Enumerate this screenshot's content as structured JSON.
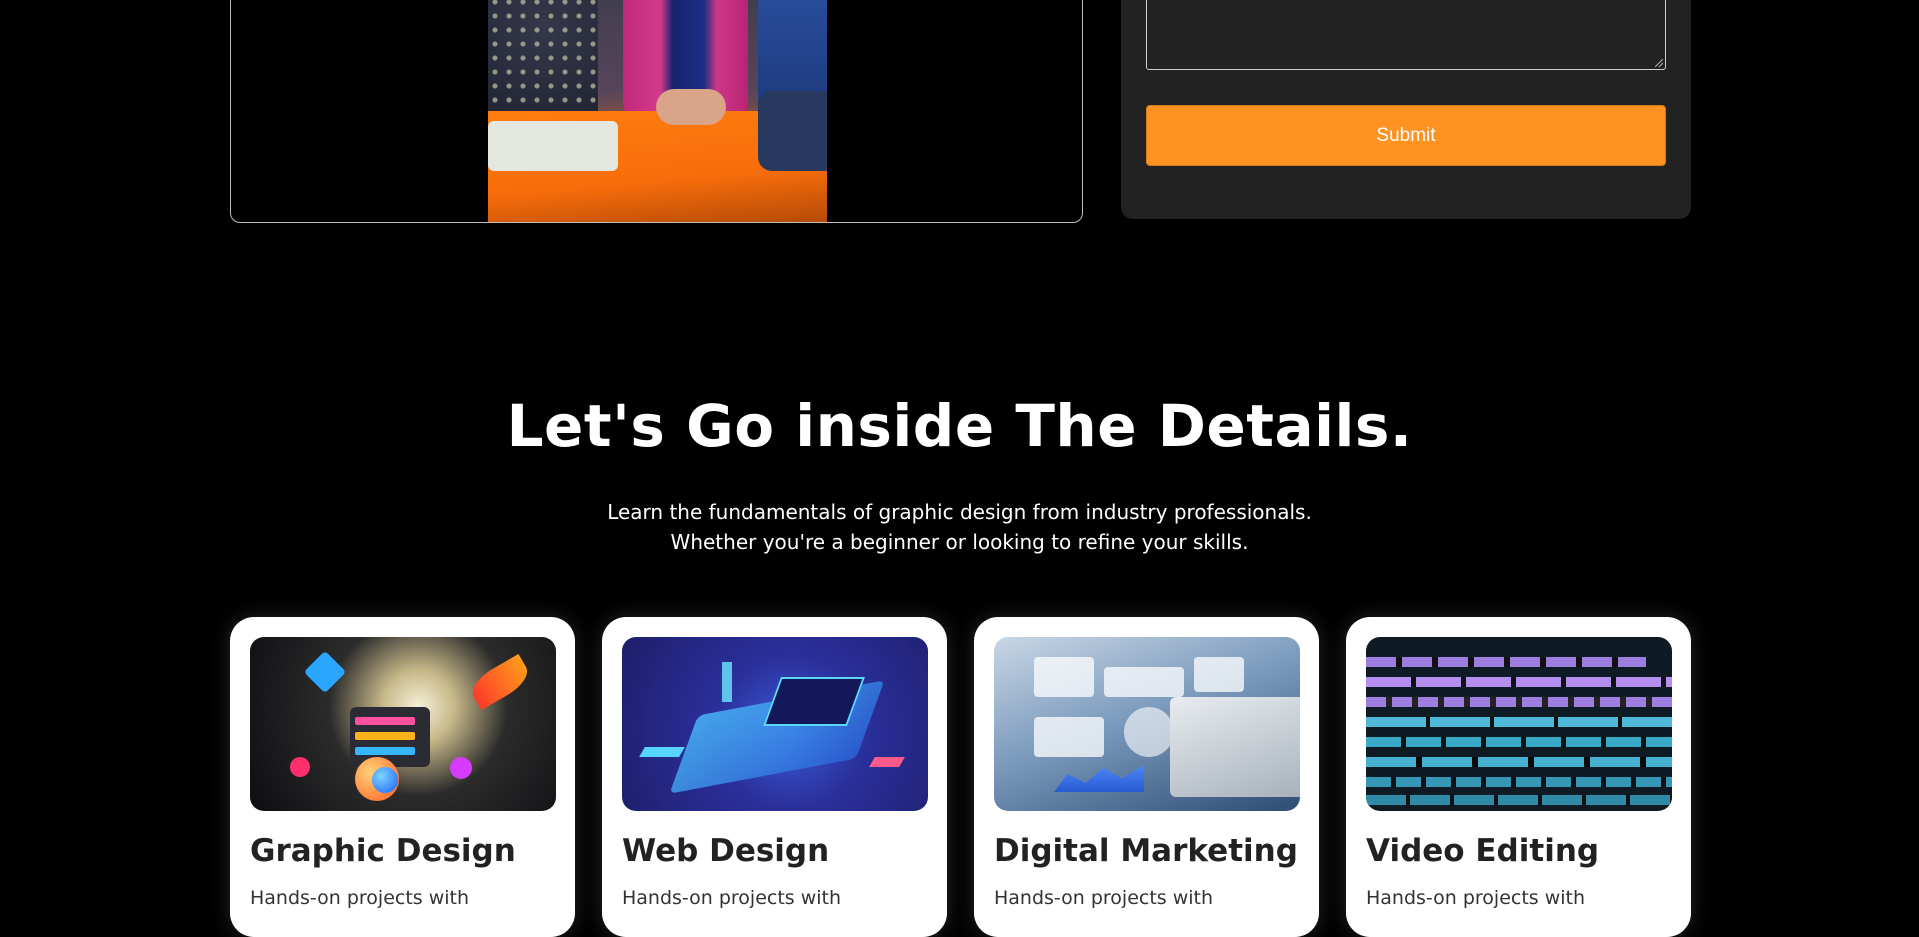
{
  "contact_form": {
    "submit_label": "Submit"
  },
  "details": {
    "title": "Let's Go inside The Details.",
    "subtitle_line1": "Learn the fundamentals of graphic design from industry professionals.",
    "subtitle_line2": "Whether you're a beginner or looking to refine your skills."
  },
  "courses": [
    {
      "title": "Graphic Design",
      "description": "Hands-on projects with"
    },
    {
      "title": "Web Design",
      "description": "Hands-on projects with"
    },
    {
      "title": "Digital Marketing",
      "description": "Hands-on projects with"
    },
    {
      "title": "Video Editing",
      "description": "Hands-on projects with"
    }
  ],
  "colors": {
    "background": "#000000",
    "panel": "#222222",
    "accent": "#ff9221",
    "card": "#ffffff"
  }
}
